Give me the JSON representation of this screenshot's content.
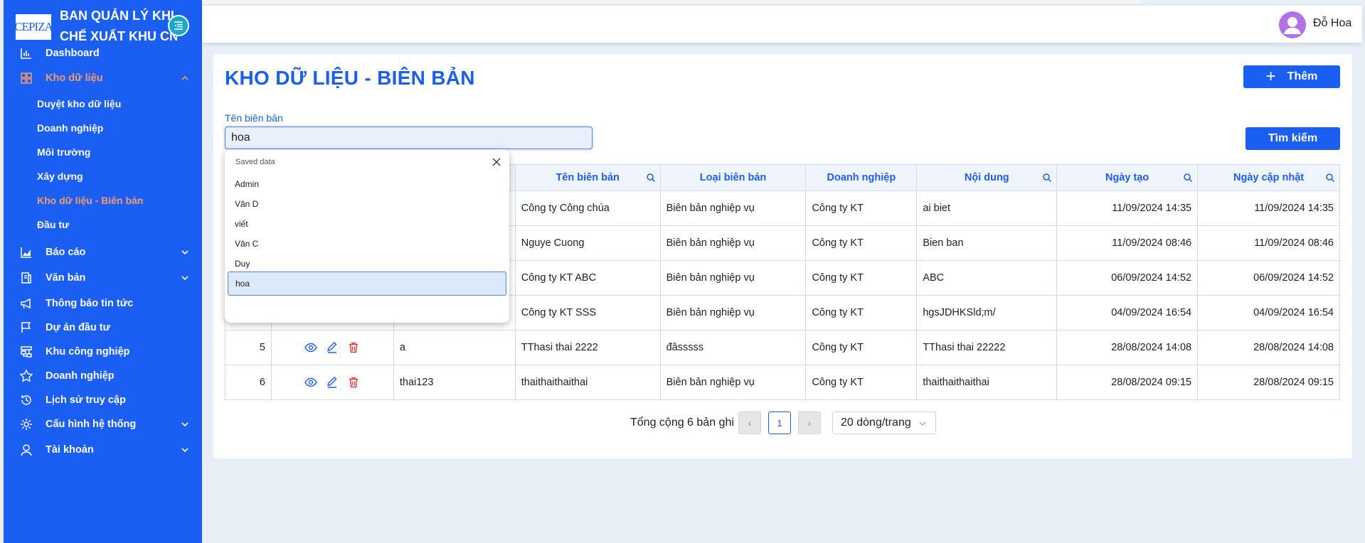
{
  "app": {
    "brand_line1": "BAN QUẢN LÝ KHU",
    "brand_line2": "CHẾ XUẤT KHU CN",
    "logo_text": "CEPIZA"
  },
  "sidebar": {
    "items": [
      {
        "label": "Dashboard",
        "icon": "bar-chart-icon"
      },
      {
        "label": "Kho dữ liệu",
        "icon": "grid-icon",
        "active": true,
        "expanded": true
      },
      {
        "label": "Báo cáo",
        "icon": "area-chart-icon"
      },
      {
        "label": "Văn bản",
        "icon": "document-icon"
      },
      {
        "label": "Thông báo tin tức",
        "icon": "megaphone-icon"
      },
      {
        "label": "Dự án đầu tư",
        "icon": "flag-icon"
      },
      {
        "label": "Khu công nghiệp",
        "icon": "cluster-icon"
      },
      {
        "label": "Doanh nghiệp",
        "icon": "star-icon"
      },
      {
        "label": "Lịch sử truy cập",
        "icon": "history-icon"
      },
      {
        "label": "Cấu hình hệ thống",
        "icon": "gear-icon"
      },
      {
        "label": "Tài khoản",
        "icon": "user-icon"
      }
    ],
    "subitems": [
      {
        "label": "Duyệt kho dữ liệu"
      },
      {
        "label": "Doanh nghiệp"
      },
      {
        "label": "Môi trường"
      },
      {
        "label": "Xây dựng"
      },
      {
        "label": "Kho dữ liệu - Biên bản",
        "active": true
      },
      {
        "label": "Đầu tư"
      }
    ]
  },
  "header": {
    "user_name": "Đỗ Hoa"
  },
  "page": {
    "title": "KHO DỮ LIỆU - BIÊN BẢN",
    "add_label": "Thêm",
    "search_label": "Tìm kiếm",
    "field_label": "Tên biên bản",
    "field_value": "hoa"
  },
  "table": {
    "headers": [
      "Tên biên bản",
      "Loại biên bản",
      "Doanh nghiệp",
      "Nội dung",
      "Ngày tạo",
      "Ngày cập nhật"
    ],
    "rows": [
      {
        "stt": "",
        "code": "",
        "name": "Công ty Công chúa",
        "type": "Biên bản nghiệp vụ",
        "company": "Công ty KT",
        "content": "ai biet",
        "created": "11/09/2024 14:35",
        "updated": "11/09/2024 14:35"
      },
      {
        "stt": "",
        "code": "",
        "name": "Nguye Cuong",
        "type": "Biên bản nghiệp vụ",
        "company": "Công ty KT",
        "content": "Bien ban",
        "created": "11/09/2024 08:46",
        "updated": "11/09/2024 08:46"
      },
      {
        "stt": "",
        "code": "",
        "name": "Công ty KT ABC",
        "type": "Biên bản nghiệp vụ",
        "company": "Công ty KT",
        "content": "ABC",
        "created": "06/09/2024 14:52",
        "updated": "06/09/2024 14:52"
      },
      {
        "stt": "",
        "code": "",
        "name": "Công ty KT SSS",
        "type": "Biên bản nghiệp vụ",
        "company": "Công ty KT",
        "content": "hgsJDHKSld;m/",
        "created": "04/09/2024 16:54",
        "updated": "04/09/2024 16:54"
      },
      {
        "stt": "5",
        "code": "a",
        "name": "TThasi thai 2222",
        "type": "đâsssss",
        "company": "Công ty KT",
        "content": "TThasi thai 22222",
        "created": "28/08/2024 14:08",
        "updated": "28/08/2024 14:08"
      },
      {
        "stt": "6",
        "code": "thai123",
        "name": "thaithaithaithai",
        "type": "Biên bản nghiệp vụ",
        "company": "Công ty KT",
        "content": "thaithaithaithai",
        "created": "28/08/2024 09:15",
        "updated": "28/08/2024 09:15"
      }
    ]
  },
  "pagination": {
    "total_text": "Tổng cộng 6 bản ghi",
    "current_page": "1",
    "page_size": "20 dòng/trang"
  },
  "dropdown": {
    "header": "Saved data",
    "items": [
      "Admin",
      "Văn D",
      "viết",
      "Văn C",
      "Duy",
      "hoa"
    ],
    "selected_index": 5
  },
  "colors": {
    "primary": "#1a5ff2",
    "active": "#f59b6c",
    "delete": "#e53935",
    "avatar": "#b071e9"
  }
}
